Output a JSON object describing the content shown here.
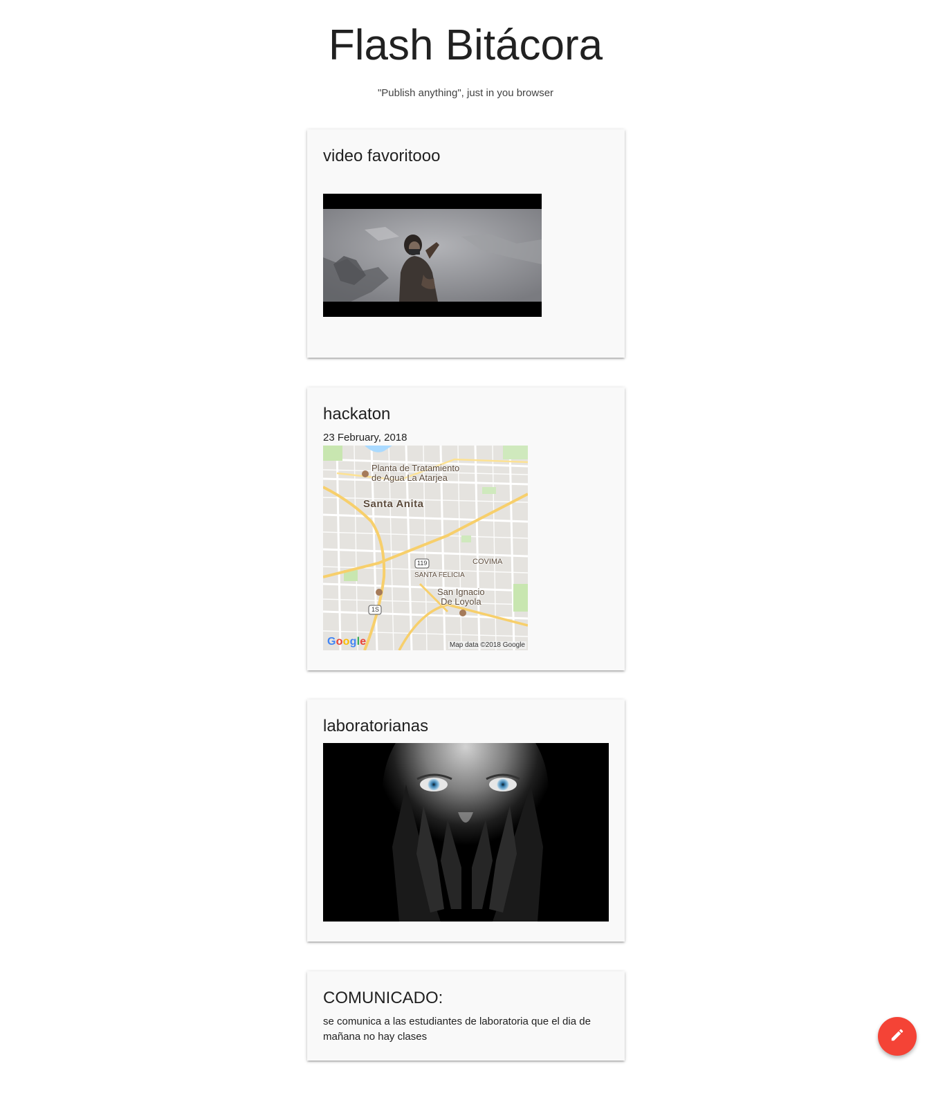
{
  "site": {
    "title": "Flash Bitácora",
    "tagline": "\"Publish anything\", just in you browser"
  },
  "posts": [
    {
      "type": "video",
      "title": "video favoritooo"
    },
    {
      "type": "map",
      "title": "hackaton",
      "date": "23 February, 2018",
      "map": {
        "labels": {
          "plant_line1": "Planta de Tratamiento",
          "plant_line2": "de Agua La Atarjea",
          "santa_anita": "Santa Anita",
          "covima": "COVIMA",
          "santa_felicia": "SANTA FELICIA",
          "san_ignacio_line1": "San Ignacio",
          "san_ignacio_line2": "De Loyola",
          "route_119": "119",
          "route_1s": "1S"
        },
        "google": "Google",
        "attribution": "Map data ©2018 Google"
      }
    },
    {
      "type": "image",
      "title": "laboratorianas"
    },
    {
      "type": "text",
      "title": "COMUNICADO:",
      "body": "se comunica a las estudiantes de laboratoria que el dia de mañana no hay clases"
    }
  ],
  "fab": {
    "icon": "pencil-icon",
    "color": "#f44336"
  }
}
